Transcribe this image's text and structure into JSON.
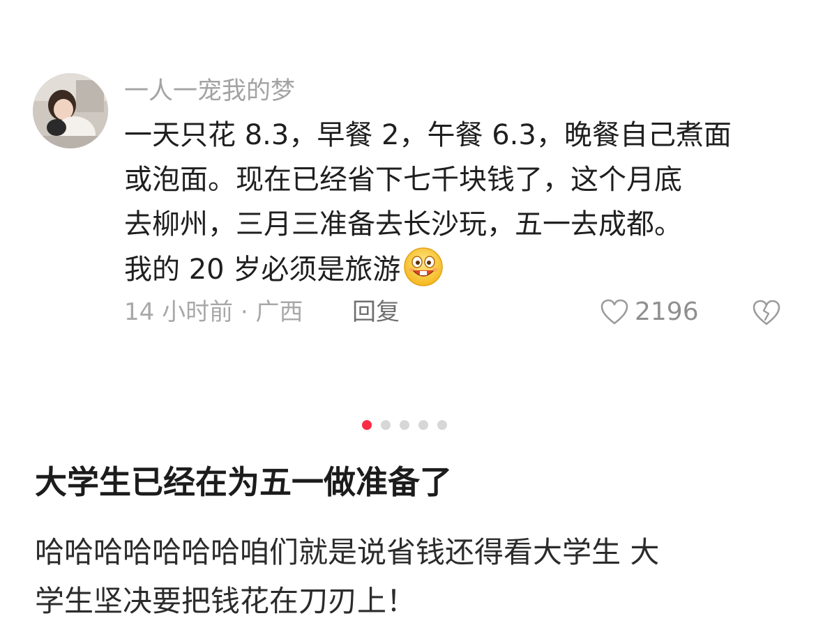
{
  "comment": {
    "username": "一人一宠我的梦",
    "lines": [
      "一天只花 8.3，早餐 2，午餐 6.3，晚餐自己煮面",
      "或泡面。现在已经省下七千块钱了，这个月底",
      "去柳州，三月三准备去长沙玩，五一去成都。",
      "我的 20 岁必须是旅游"
    ],
    "emoji_icon": "grinning-face-emoji-icon",
    "time_location": "14 小时前 · 广西",
    "reply_label": "回复",
    "like_icon": "heart-outline-icon",
    "like_count": "2196",
    "dislike_icon": "broken-heart-icon"
  },
  "pager": {
    "total": 5,
    "active_index": 0,
    "active_color": "#fb2c46",
    "inactive_color": "#d7d7d7"
  },
  "post": {
    "title": "大学生已经在为五一做准备了",
    "body_lines": [
      "哈哈哈哈哈哈哈咱们就是说省钱还得看大学生 大",
      "学生坚决要把钱花在刀刃上！"
    ]
  }
}
